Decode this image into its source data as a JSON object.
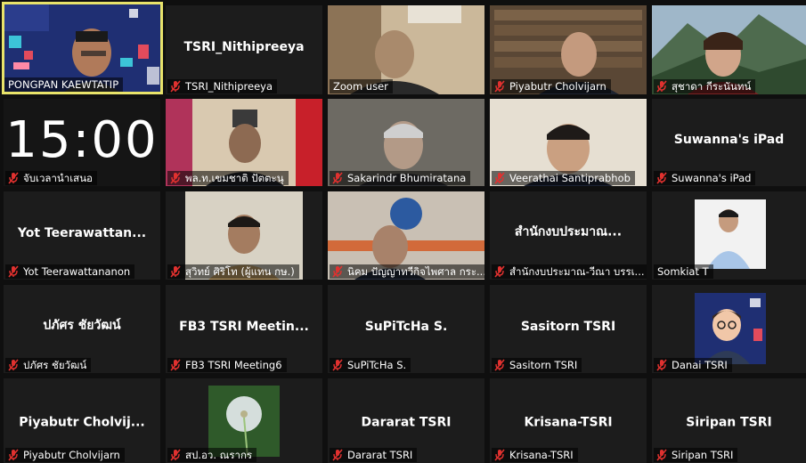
{
  "meeting": {
    "participants": [
      {
        "name": "PONGPAN KAEWTATIP",
        "display": "",
        "muted": false,
        "active": true,
        "video": true
      },
      {
        "name": "TSRI_Nithipreeya",
        "display": "TSRI_Nithipreeya",
        "muted": true,
        "video": false
      },
      {
        "name": "Zoom user",
        "display": "",
        "muted": false,
        "video": true
      },
      {
        "name": "Piyabutr Cholvijarn",
        "display": "",
        "muted": true,
        "video": true
      },
      {
        "name": "สุชาดา กีระนันทน์",
        "display": "",
        "muted": true,
        "video": true
      },
      {
        "name": "จับเวลานำเสนอ",
        "display": "15:00",
        "muted": true,
        "video": false
      },
      {
        "name": "พล.ท.เขมชาติ ปัตตะนุ",
        "display": "",
        "muted": true,
        "video": true
      },
      {
        "name": "Sakarindr Bhumiratana",
        "display": "",
        "muted": true,
        "video": true
      },
      {
        "name": "Veerathai Santiprabhob",
        "display": "",
        "muted": true,
        "video": true
      },
      {
        "name": "Suwanna's iPad",
        "display": "Suwanna's iPad",
        "muted": true,
        "video": false
      },
      {
        "name": "Yot Teerawattananon",
        "display": "Yot  Teerawattan...",
        "muted": true,
        "video": false
      },
      {
        "name": "สุวิทย์ ศิริโท (ผู้แทน กษ.)",
        "display": "",
        "muted": true,
        "video": true
      },
      {
        "name": "นิคม ปัญญาทวีกิจไพศาล กระ...",
        "display": "",
        "muted": true,
        "video": true
      },
      {
        "name": "สำนักงบประมาณ-วีณา บรรเ...",
        "display": "สำนักงบประมาณ...",
        "muted": true,
        "video": false
      },
      {
        "name": "Somkiat T",
        "display": "",
        "muted": false,
        "video": true
      },
      {
        "name": "ปภัศร ชัยวัฒน์",
        "display": "ปภัศร ชัยวัฒน์",
        "muted": true,
        "video": false
      },
      {
        "name": "FB3 TSRI Meeting6",
        "display": "FB3 TSRI Meetin...",
        "muted": true,
        "video": false
      },
      {
        "name": "SuPiTcHa S.",
        "display": "SuPiTcHa S.",
        "muted": true,
        "video": false
      },
      {
        "name": "Sasitorn TSRI",
        "display": "Sasitorn TSRI",
        "muted": true,
        "video": false
      },
      {
        "name": "Danai TSRI",
        "display": "",
        "muted": true,
        "video": true
      },
      {
        "name": "Piyabutr Cholvijarn",
        "display": "Piyabutr  Cholvij...",
        "muted": true,
        "video": false
      },
      {
        "name": "สป.อว. ณรากร",
        "display": "",
        "muted": true,
        "video": true
      },
      {
        "name": "Dararat TSRI",
        "display": "Dararat TSRI",
        "muted": true,
        "video": false
      },
      {
        "name": "Krisana-TSRI",
        "display": "Krisana-TSRI",
        "muted": true,
        "video": false
      },
      {
        "name": "Siripan TSRI",
        "display": "Siripan TSRI",
        "muted": true,
        "video": false
      }
    ]
  },
  "colors": {
    "background": "#0f0f0f",
    "tile": "#1c1c1c",
    "active_border": "#e8e36a",
    "mute_icon": "#e0312f"
  },
  "icons": {
    "muted": "mic-off-icon"
  }
}
